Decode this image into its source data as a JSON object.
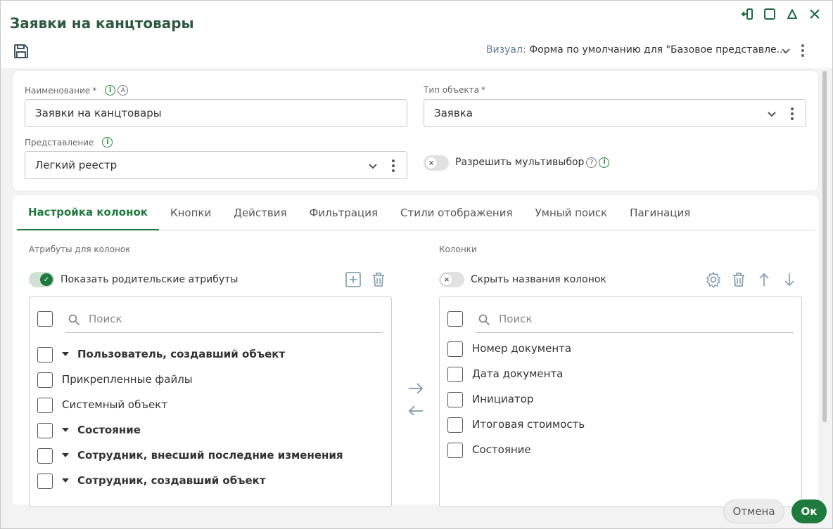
{
  "window": {
    "title": "Заявки на канцтовары",
    "visual_label": "Визуал:",
    "visual_value": "Форма по умолчанию для \"Базовое представле..."
  },
  "form": {
    "name_label": "Наименование",
    "name_required": "*",
    "name_value": "Заявки на канцтовары",
    "type_label": "Тип объекта",
    "type_required": "*",
    "type_value": "Заявка",
    "view_label": "Представление",
    "view_value": "Легкий реестр",
    "multiselect_label": "Разрешить мультивыбор",
    "multiselect_enabled": false
  },
  "tabs": [
    "Настройка колонок",
    "Кнопки",
    "Действия",
    "Фильтрация",
    "Стили отображения",
    "Умный поиск",
    "Пагинация"
  ],
  "left_panel": {
    "title": "Атрибуты для колонок",
    "toggle_label": "Показать родительские атрибуты",
    "toggle_enabled": true,
    "search_placeholder": "Поиск",
    "items": [
      {
        "label": "Пользователь, создавший объект",
        "expandable": true
      },
      {
        "label": "Прикрепленные файлы",
        "expandable": false
      },
      {
        "label": "Системный объект",
        "expandable": false
      },
      {
        "label": "Состояние",
        "expandable": true
      },
      {
        "label": "Сотрудник, внесший последние изменения",
        "expandable": true
      },
      {
        "label": "Сотрудник, создавший объект",
        "expandable": true
      }
    ]
  },
  "right_panel": {
    "title": "Колонки",
    "toggle_label": "Скрыть названия колонок",
    "toggle_enabled": false,
    "search_placeholder": "Поиск",
    "items": [
      "Номер документа",
      "Дата документа",
      "Инициатор",
      "Итоговая стоимость",
      "Состояние"
    ]
  },
  "footer": {
    "cancel_label": "Отмена",
    "ok_label": "Ок"
  },
  "icons": {
    "info": "i",
    "autofill": "A",
    "help": "?",
    "toggle_off": "×",
    "toggle_on": "✓"
  },
  "colors": {
    "accent": "#1f7a3d",
    "title": "#2e5a40"
  }
}
